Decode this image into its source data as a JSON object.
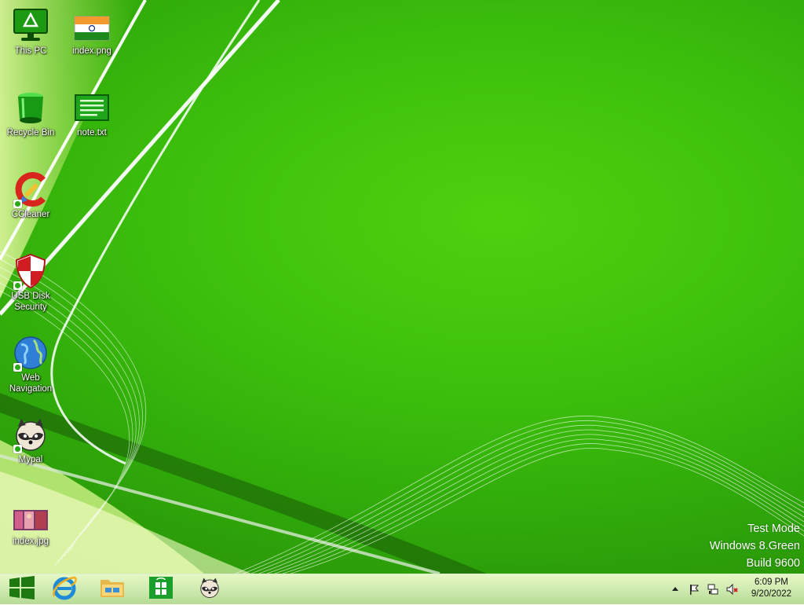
{
  "desktop": {
    "icons": [
      {
        "label": "This PC",
        "icon": "this-pc-icon"
      },
      {
        "label": "index.png",
        "icon": "image-file-icon"
      },
      {
        "label": "Recycle Bin",
        "icon": "recycle-bin-icon"
      },
      {
        "label": "note.txt",
        "icon": "text-file-icon"
      },
      {
        "label": "CCleaner",
        "icon": "ccleaner-icon"
      },
      {
        "label": "USB Disk Security",
        "icon": "shield-icon"
      },
      {
        "label": "Web Navigation",
        "icon": "globe-icon"
      },
      {
        "label": "Mypal",
        "icon": "raccoon-icon"
      },
      {
        "label": "index.jpg",
        "icon": "photo-file-icon"
      }
    ]
  },
  "watermark": {
    "line1": "Test Mode",
    "line2": "Windows 8.Green",
    "line3": "Build 9600"
  },
  "taskbar": {
    "pinned": [
      {
        "name": "start-button",
        "icon": "windows-logo-icon"
      },
      {
        "name": "internet-explorer",
        "icon": "internet-explorer-icon"
      },
      {
        "name": "file-explorer",
        "icon": "folder-icon"
      },
      {
        "name": "store",
        "icon": "store-icon"
      },
      {
        "name": "mypal",
        "icon": "raccoon-icon"
      }
    ],
    "tray": {
      "icons": [
        "chevron-up-icon",
        "flag-icon",
        "network-icon",
        "volume-muted-icon"
      ],
      "time": "6:09 PM",
      "date": "9/20/2022"
    }
  },
  "colors": {
    "wallpaper_green": "#3cbf0c",
    "accent_green": "#2aa815"
  }
}
